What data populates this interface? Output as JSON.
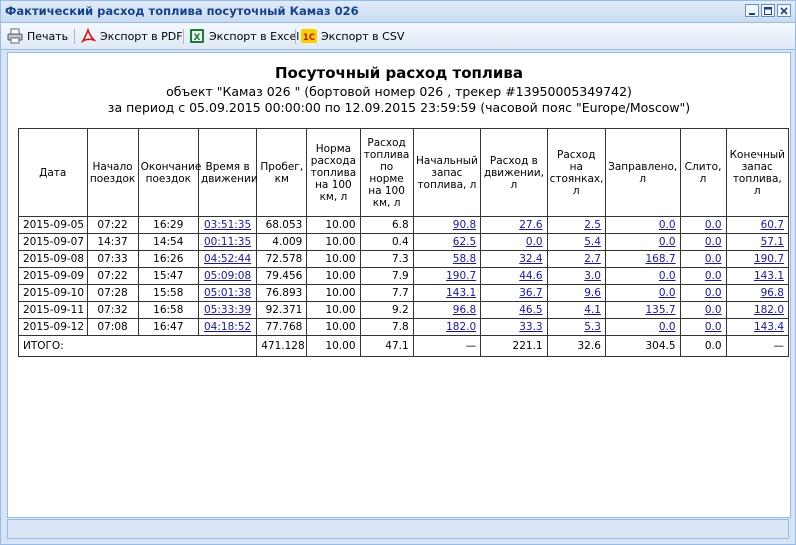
{
  "window": {
    "title": "Фактический расход топлива посуточный Камаз 026"
  },
  "toolbar": {
    "print_label": "Печать",
    "pdf_label": "Экспорт в PDF",
    "excel_label": "Экспорт в Excel",
    "csv_label": "Экспорт в CSV",
    "excel_icon_letter": "X",
    "csv_icon_text": "1С"
  },
  "report": {
    "title": "Посуточный расход топлива",
    "subtitle_object": "объект \"Камаз 026         \" (бортовой номер 026       , трекер #13950005349742)",
    "subtitle_period": "за период с 05.09.2015 00:00:00 по 12.09.2015 23:59:59 (часовой пояс \"Europe/Moscow\")"
  },
  "table": {
    "headers": [
      "Дата",
      "Начало поездок",
      "Окончание поездок",
      "Время в движении",
      "Пробег, км",
      "Норма расхода топлива на 100 км, л",
      "Расход топлива по норме на 100 км, л",
      "Начальный запас топлива, л",
      "Расход в движении, л",
      "Расход на стоянках, л",
      "Заправлено, л",
      "Слито, л",
      "Конечный запас топлива, л"
    ],
    "rows": [
      [
        "2015-09-05",
        "07:22",
        "16:29",
        "03:51:35",
        "68.053",
        "10.00",
        "6.8",
        "90.8",
        "27.6",
        "2.5",
        "0.0",
        "0.0",
        "60.7"
      ],
      [
        "2015-09-07",
        "14:37",
        "14:54",
        "00:11:35",
        "4.009",
        "10.00",
        "0.4",
        "62.5",
        "0.0",
        "5.4",
        "0.0",
        "0.0",
        "57.1"
      ],
      [
        "2015-09-08",
        "07:33",
        "16:26",
        "04:52:44",
        "72.578",
        "10.00",
        "7.3",
        "58.8",
        "32.4",
        "2.7",
        "168.7",
        "0.0",
        "190.7"
      ],
      [
        "2015-09-09",
        "07:22",
        "15:47",
        "05:09:08",
        "79.456",
        "10.00",
        "7.9",
        "190.7",
        "44.6",
        "3.0",
        "0.0",
        "0.0",
        "143.1"
      ],
      [
        "2015-09-10",
        "07:28",
        "15:58",
        "05:01:38",
        "76.893",
        "10.00",
        "7.7",
        "143.1",
        "36.7",
        "9.6",
        "0.0",
        "0.0",
        "96.8"
      ],
      [
        "2015-09-11",
        "07:32",
        "16:58",
        "05:33:39",
        "92.371",
        "10.00",
        "9.2",
        "96.8",
        "46.5",
        "4.1",
        "135.7",
        "0.0",
        "182.0"
      ],
      [
        "2015-09-12",
        "07:08",
        "16:47",
        "04:18:52",
        "77.768",
        "10.00",
        "7.8",
        "182.0",
        "33.3",
        "5.3",
        "0.0",
        "0.0",
        "143.4"
      ]
    ],
    "total": {
      "label": "ИТОГО:",
      "mileage": "471.128",
      "norm": "10.00",
      "norm_consumption": "47.1",
      "start_fuel": "—",
      "moving": "221.1",
      "parking": "32.6",
      "filled": "304.5",
      "drained": "0.0",
      "end_fuel": "—"
    }
  },
  "colors": {
    "title_text": "#15428b",
    "link": "#1a1a8c",
    "window_border": "#99bbe8"
  }
}
